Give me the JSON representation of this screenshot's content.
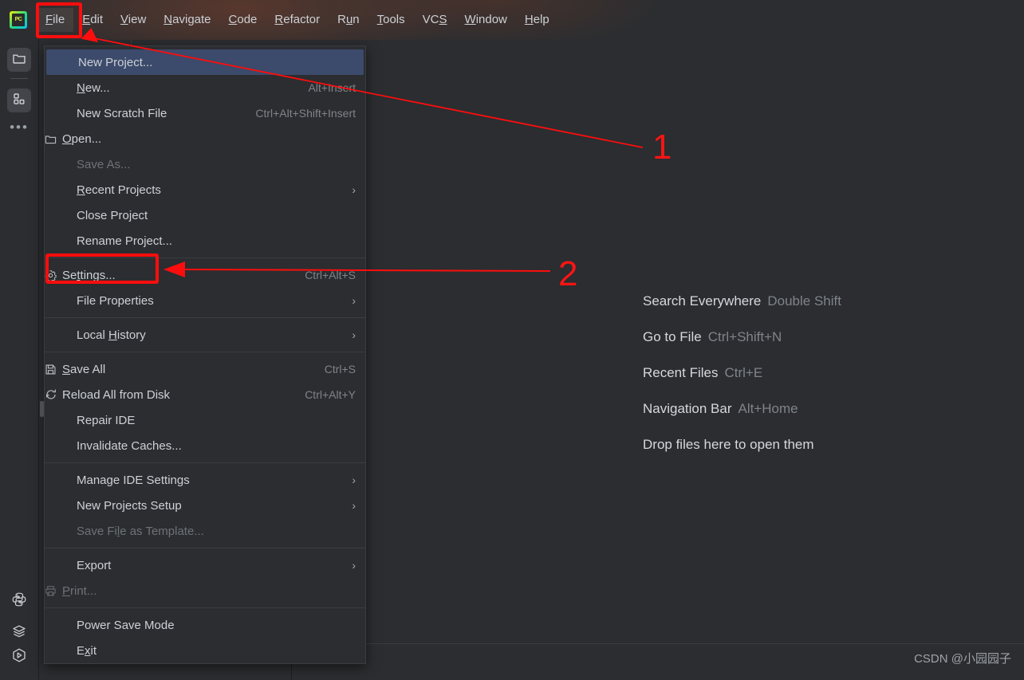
{
  "app": {
    "logo_text": "PC",
    "background_color": "#2b2d30",
    "accent_color": "#3c4a6b",
    "annotation_color": "#fd0d0d"
  },
  "top_progress": {
    "label": "indexing-progress"
  },
  "menubar": {
    "items": [
      {
        "label": "File",
        "mnemonic": "F",
        "active": true
      },
      {
        "label": "Edit",
        "mnemonic": "E",
        "active": false
      },
      {
        "label": "View",
        "mnemonic": "V",
        "active": false
      },
      {
        "label": "Navigate",
        "mnemonic": "N",
        "active": false
      },
      {
        "label": "Code",
        "mnemonic": "C",
        "active": false
      },
      {
        "label": "Refactor",
        "mnemonic": "R",
        "active": false
      },
      {
        "label": "Run",
        "mnemonic": "u",
        "active": false
      },
      {
        "label": "Tools",
        "mnemonic": "T",
        "active": false
      },
      {
        "label": "VCS",
        "mnemonic": "S",
        "active": false
      },
      {
        "label": "Window",
        "mnemonic": "W",
        "active": false
      },
      {
        "label": "Help",
        "mnemonic": "H",
        "active": false
      }
    ]
  },
  "sidebar": {
    "top_items": [
      {
        "icon": "folder-icon",
        "name": "project-tool-window",
        "selected": true
      },
      {
        "icon": "structure-icon",
        "name": "structure-tool-window",
        "selected": true
      },
      {
        "icon": "more-icon",
        "name": "more-tool-windows",
        "selected": false
      }
    ],
    "bottom_items": [
      {
        "icon": "python-icon",
        "name": "python-console",
        "selected": false
      },
      {
        "icon": "layers-icon",
        "name": "services-tool-window",
        "selected": false
      },
      {
        "icon": "run-icon",
        "name": "run-tool-window",
        "selected": false
      }
    ]
  },
  "file_menu": {
    "title": "File",
    "groups": [
      {
        "items": [
          {
            "label": "New Project...",
            "accel": "",
            "icon": "",
            "selected": true,
            "disabled": false,
            "submenu": false,
            "mnemonic": ""
          },
          {
            "label": "New...",
            "accel": "Alt+Insert",
            "icon": "",
            "selected": false,
            "disabled": false,
            "submenu": false,
            "mnemonic": "N"
          },
          {
            "label": "New Scratch File",
            "accel": "Ctrl+Alt+Shift+Insert",
            "icon": "",
            "selected": false,
            "disabled": false,
            "submenu": false,
            "mnemonic": ""
          },
          {
            "label": "Open...",
            "accel": "",
            "icon": "folder-icon",
            "selected": false,
            "disabled": false,
            "submenu": false,
            "mnemonic": "O"
          },
          {
            "label": "Save As...",
            "accel": "",
            "icon": "",
            "selected": false,
            "disabled": true,
            "submenu": false,
            "mnemonic": ""
          },
          {
            "label": "Recent Projects",
            "accel": "",
            "icon": "",
            "selected": false,
            "disabled": false,
            "submenu": true,
            "mnemonic": "R"
          },
          {
            "label": "Close Project",
            "accel": "",
            "icon": "",
            "selected": false,
            "disabled": false,
            "submenu": false,
            "mnemonic": ""
          },
          {
            "label": "Rename Project...",
            "accel": "",
            "icon": "",
            "selected": false,
            "disabled": false,
            "submenu": false,
            "mnemonic": ""
          }
        ]
      },
      {
        "items": [
          {
            "label": "Settings...",
            "accel": "Ctrl+Alt+S",
            "icon": "gear-icon",
            "selected": false,
            "disabled": false,
            "submenu": false,
            "mnemonic": "t"
          },
          {
            "label": "File Properties",
            "accel": "",
            "icon": "",
            "selected": false,
            "disabled": false,
            "submenu": true,
            "mnemonic": ""
          }
        ]
      },
      {
        "items": [
          {
            "label": "Local History",
            "accel": "",
            "icon": "",
            "selected": false,
            "disabled": false,
            "submenu": true,
            "mnemonic": "H"
          }
        ]
      },
      {
        "items": [
          {
            "label": "Save All",
            "accel": "Ctrl+S",
            "icon": "save-icon",
            "selected": false,
            "disabled": false,
            "submenu": false,
            "mnemonic": "S"
          },
          {
            "label": "Reload All from Disk",
            "accel": "Ctrl+Alt+Y",
            "icon": "reload-icon",
            "selected": false,
            "disabled": false,
            "submenu": false,
            "mnemonic": ""
          },
          {
            "label": "Repair IDE",
            "accel": "",
            "icon": "",
            "selected": false,
            "disabled": false,
            "submenu": false,
            "mnemonic": ""
          },
          {
            "label": "Invalidate Caches...",
            "accel": "",
            "icon": "",
            "selected": false,
            "disabled": false,
            "submenu": false,
            "mnemonic": ""
          }
        ]
      },
      {
        "items": [
          {
            "label": "Manage IDE Settings",
            "accel": "",
            "icon": "",
            "selected": false,
            "disabled": false,
            "submenu": true,
            "mnemonic": ""
          },
          {
            "label": "New Projects Setup",
            "accel": "",
            "icon": "",
            "selected": false,
            "disabled": false,
            "submenu": true,
            "mnemonic": ""
          },
          {
            "label": "Save File as Template...",
            "accel": "",
            "icon": "",
            "selected": false,
            "disabled": true,
            "submenu": false,
            "mnemonic": "l"
          }
        ]
      },
      {
        "items": [
          {
            "label": "Export",
            "accel": "",
            "icon": "",
            "selected": false,
            "disabled": false,
            "submenu": true,
            "mnemonic": ""
          },
          {
            "label": "Print...",
            "accel": "",
            "icon": "print-icon",
            "selected": false,
            "disabled": true,
            "submenu": false,
            "mnemonic": "P"
          }
        ]
      },
      {
        "items": [
          {
            "label": "Power Save Mode",
            "accel": "",
            "icon": "",
            "selected": false,
            "disabled": false,
            "submenu": false,
            "mnemonic": ""
          },
          {
            "label": "Exit",
            "accel": "",
            "icon": "",
            "selected": false,
            "disabled": false,
            "submenu": false,
            "mnemonic": "x"
          }
        ]
      }
    ]
  },
  "hints": [
    {
      "name": "Search Everywhere",
      "key": "Double Shift"
    },
    {
      "name": "Go to File",
      "key": "Ctrl+Shift+N"
    },
    {
      "name": "Recent Files",
      "key": "Ctrl+E"
    },
    {
      "name": "Navigation Bar",
      "key": "Alt+Home"
    },
    {
      "name": "Drop files here to open them",
      "key": ""
    }
  ],
  "annotations": {
    "step_one": "1",
    "step_two": "2",
    "highlight_file": "File",
    "highlight_settings": "Settings..."
  },
  "watermark": "CSDN @小园园子"
}
